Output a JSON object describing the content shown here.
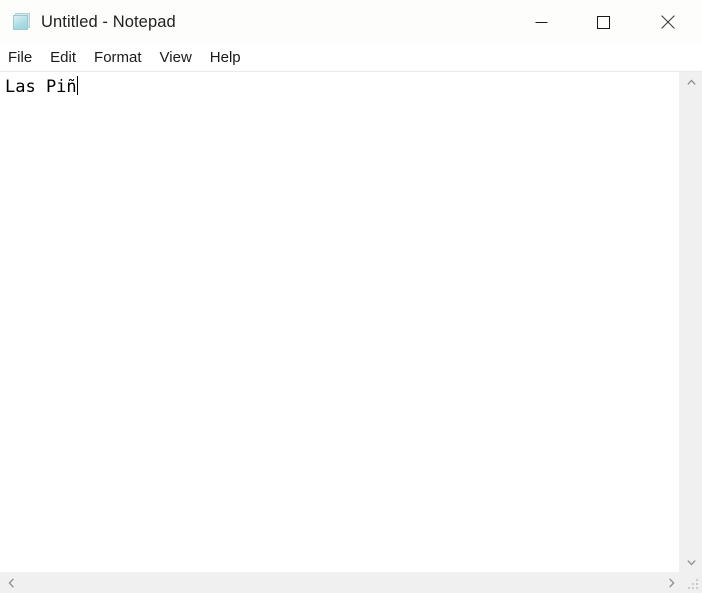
{
  "window": {
    "title": "Untitled - Notepad",
    "app_icon": "notepad-icon",
    "background_color": "#ffffff",
    "titlebar_color": "#fdfefc"
  },
  "window_controls": [
    {
      "name": "minimize",
      "icon": "minimize-icon",
      "glyph": "—",
      "tooltip": "Minimize"
    },
    {
      "name": "maximize",
      "icon": "maximize-icon",
      "glyph": "□",
      "tooltip": "Maximize"
    },
    {
      "name": "close",
      "icon": "close-icon",
      "glyph": "✕",
      "tooltip": "Close"
    }
  ],
  "menubar": {
    "items": [
      {
        "label": "File"
      },
      {
        "label": "Edit"
      },
      {
        "label": "Format"
      },
      {
        "label": "View"
      },
      {
        "label": "Help"
      }
    ]
  },
  "editor": {
    "content": "Las Piñ",
    "caret_visible": true,
    "font": "monospace",
    "text_color": "#000000",
    "background_color": "#ffffff"
  },
  "scrollbars": {
    "vertical": {
      "up_arrow_icon": "chevron-up-icon",
      "down_arrow_icon": "chevron-down-icon",
      "track_color": "#f0f0f0",
      "thumb_visible": false
    },
    "horizontal": {
      "left_arrow_icon": "chevron-left-icon",
      "right_arrow_icon": "chevron-right-icon",
      "track_color": "#f0f0f0",
      "thumb_visible": false
    },
    "resize_grip_icon": "resize-grip-icon"
  }
}
